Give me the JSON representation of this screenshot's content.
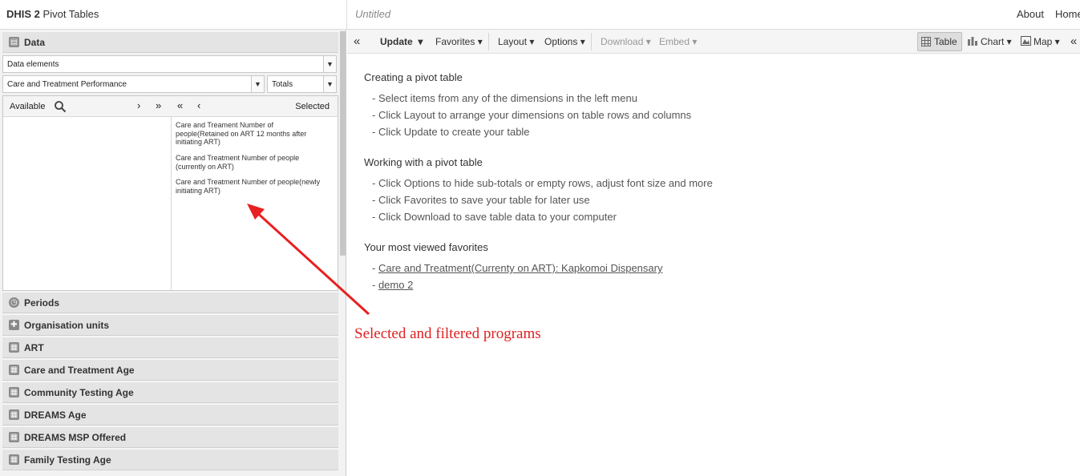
{
  "header": {
    "brand": "DHIS 2",
    "app_name": "Pivot Tables",
    "favorite_title": "Untitled",
    "nav": {
      "about": "About",
      "home": "Home"
    }
  },
  "left_panel": {
    "data_section": {
      "label": "Data",
      "data_type_select": "Data elements",
      "group_select": "Care and Treatment Performance",
      "detail_select": "Totals",
      "available_label": "Available",
      "selected_label": "Selected",
      "available_items": [],
      "selected_items": [
        "Care and Treament Number of people(Retained on ART 12 months after initiating ART)",
        "Care and Treatment Number of people (currently on ART)",
        "Care and Treatment Number of people(newly initiating ART)"
      ]
    },
    "sections": [
      {
        "label": "Periods",
        "icon": "clock-icon"
      },
      {
        "label": "Organisation units",
        "icon": "plus-icon"
      },
      {
        "label": "ART",
        "icon": "grid-icon"
      },
      {
        "label": "Care and Treatment Age",
        "icon": "grid-icon"
      },
      {
        "label": "Community Testing Age",
        "icon": "grid-icon"
      },
      {
        "label": "DREAMS Age",
        "icon": "grid-icon"
      },
      {
        "label": "DREAMS MSP Offered",
        "icon": "grid-icon"
      },
      {
        "label": "Family Testing Age",
        "icon": "grid-icon"
      }
    ]
  },
  "toolbar": {
    "collapse": "«",
    "update": "Update",
    "favorites": "Favorites",
    "layout": "Layout",
    "options": "Options",
    "download": "Download",
    "embed": "Embed",
    "table": "Table",
    "chart": "Chart",
    "map": "Map",
    "expand": "«"
  },
  "content": {
    "creating": {
      "title": "Creating a pivot table",
      "items": [
        "- Select items from any of the dimensions in the left menu",
        "- Click Layout to arrange your dimensions on table rows and columns",
        "- Click Update to create your table"
      ]
    },
    "working": {
      "title": "Working with a pivot table",
      "items": [
        "- Click Options to hide sub-totals or empty rows, adjust font size and more",
        "- Click Favorites to save your table for later use",
        "- Click Download to save table data to your computer"
      ]
    },
    "favorites": {
      "title": "Your most viewed favorites",
      "prefix": "- ",
      "items": [
        "Care and Treatment(Currenty on ART): Kapkomoi Dispensary",
        "demo 2"
      ]
    }
  },
  "annotation": {
    "text": "Selected and filtered programs",
    "color": "#e02020"
  }
}
